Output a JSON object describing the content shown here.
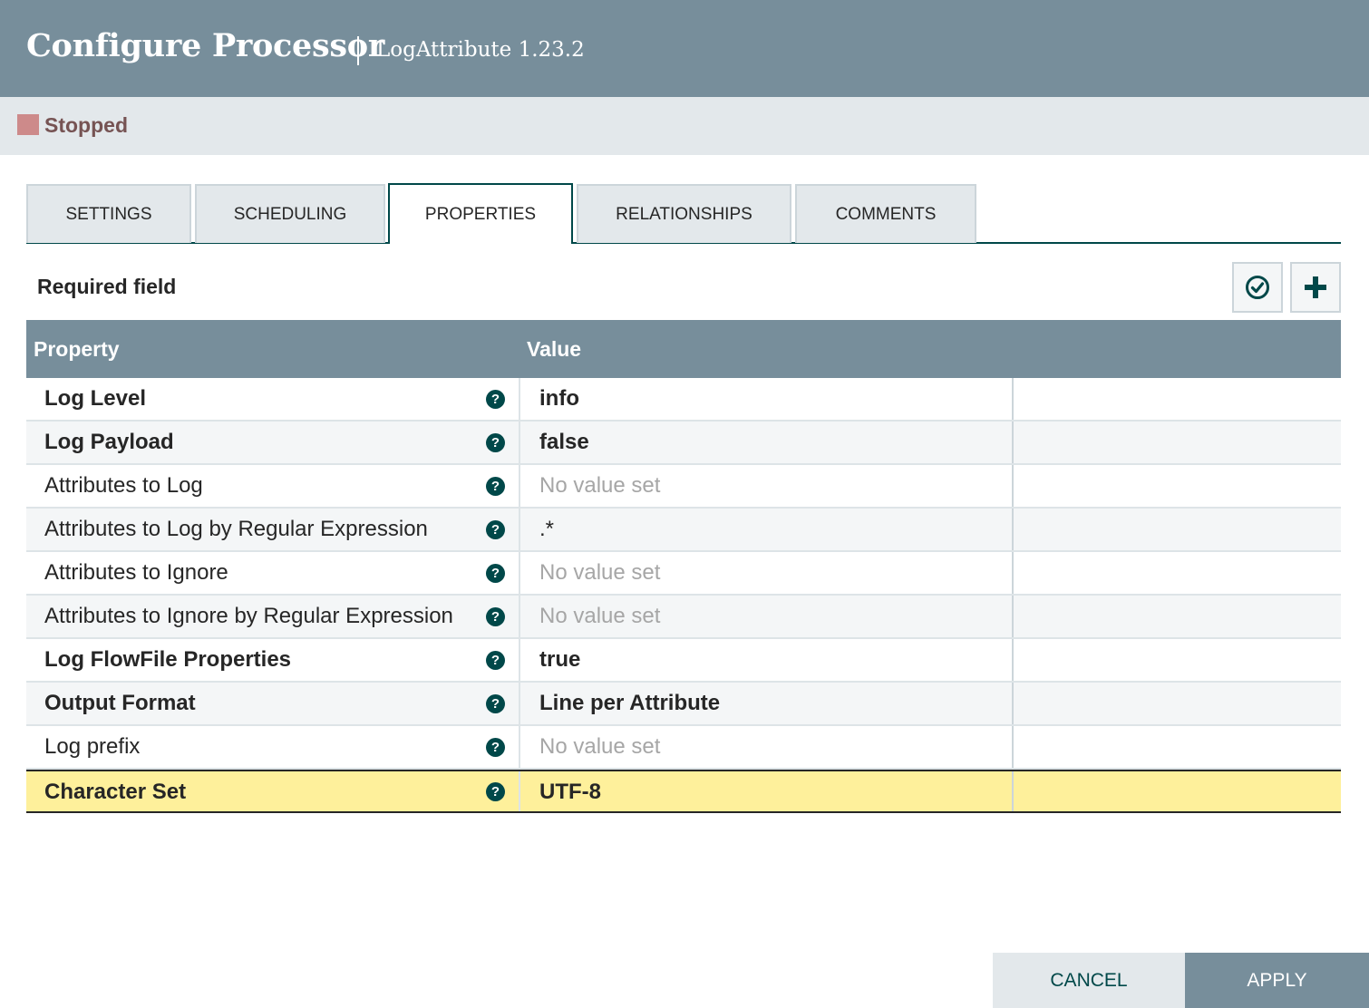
{
  "header": {
    "title": "Configure Processor",
    "subtitle": "LogAttribute 1.23.2"
  },
  "status": {
    "text": "Stopped",
    "color": "#cd8a8a"
  },
  "tabs": [
    {
      "label": "SETTINGS",
      "active": false
    },
    {
      "label": "SCHEDULING",
      "active": false
    },
    {
      "label": "PROPERTIES",
      "active": true
    },
    {
      "label": "RELATIONSHIPS",
      "active": false
    },
    {
      "label": "COMMENTS",
      "active": false
    }
  ],
  "properties_panel": {
    "required_label": "Required field",
    "verify_icon": "check-circle-icon",
    "add_icon": "plus-icon"
  },
  "table": {
    "columns": [
      "Property",
      "Value"
    ],
    "rows": [
      {
        "name": "Log Level",
        "value": "info",
        "required": true,
        "empty": false
      },
      {
        "name": "Log Payload",
        "value": "false",
        "required": true,
        "empty": false
      },
      {
        "name": "Attributes to Log",
        "value": "No value set",
        "required": false,
        "empty": true
      },
      {
        "name": "Attributes to Log by Regular Expression",
        "value": ".*",
        "required": false,
        "empty": false
      },
      {
        "name": "Attributes to Ignore",
        "value": "No value set",
        "required": false,
        "empty": true
      },
      {
        "name": "Attributes to Ignore by Regular Expression",
        "value": "No value set",
        "required": false,
        "empty": true
      },
      {
        "name": "Log FlowFile Properties",
        "value": "true",
        "required": true,
        "empty": false
      },
      {
        "name": "Output Format",
        "value": "Line per Attribute",
        "required": true,
        "empty": false
      },
      {
        "name": "Log prefix",
        "value": "No value set",
        "required": false,
        "empty": true
      },
      {
        "name": "Character Set",
        "value": "UTF-8",
        "required": true,
        "empty": false,
        "selected": true
      }
    ]
  },
  "footer": {
    "cancel_label": "CANCEL",
    "apply_label": "APPLY"
  }
}
